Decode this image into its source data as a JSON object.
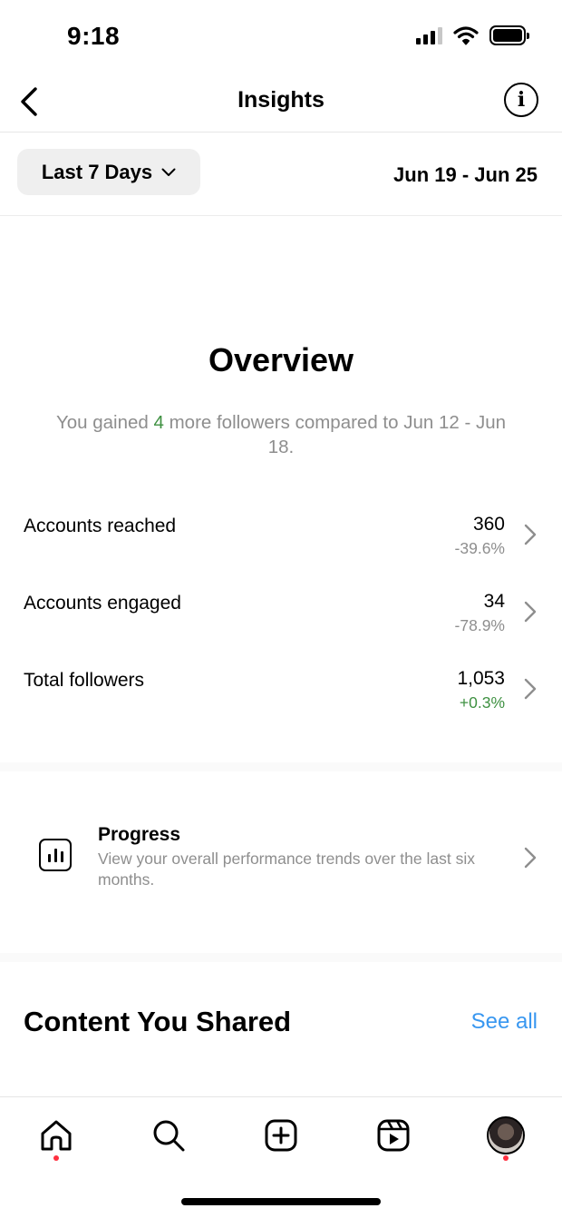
{
  "status_bar": {
    "time": "9:18"
  },
  "header": {
    "title": "Insights",
    "info_glyph": "i"
  },
  "filter": {
    "range_label": "Last 7 Days",
    "date_range": "Jun 19 - Jun 25"
  },
  "overview": {
    "title": "Overview",
    "summary_prefix": "You gained ",
    "summary_count": "4",
    "summary_suffix": " more followers compared to Jun 12 - Jun 18."
  },
  "metrics": [
    {
      "label": "Accounts reached",
      "value": "360",
      "change": "-39.6%"
    },
    {
      "label": "Accounts engaged",
      "value": "34",
      "change": "-78.9%"
    },
    {
      "label": "Total followers",
      "value": "1,053",
      "change": "+0.3%"
    }
  ],
  "progress": {
    "title": "Progress",
    "description": "View your overall performance trends over the last six months."
  },
  "content": {
    "title": "Content You Shared",
    "see_all": "See all"
  },
  "tab_bar": {
    "tabs": [
      "home-icon",
      "search-icon",
      "create-icon",
      "reels-icon",
      "profile-avatar"
    ]
  },
  "colors": {
    "positive": "#3f9142",
    "link": "#3897f0",
    "muted": "#8e8e8e",
    "notification_dot": "#ff3040"
  }
}
